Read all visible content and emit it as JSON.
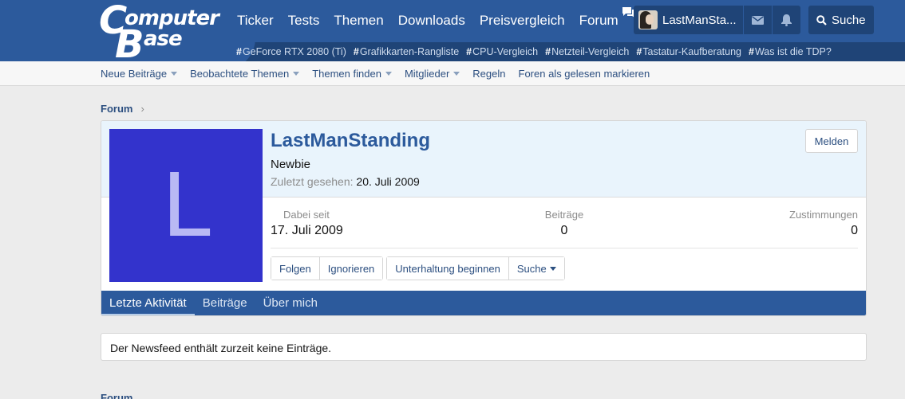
{
  "header": {
    "logo": {
      "line1": "omputer",
      "line2": "ase",
      "letter1": "C",
      "letter2": "B"
    },
    "nav": [
      "Ticker",
      "Tests",
      "Themen",
      "Downloads",
      "Preisvergleich",
      "Forum"
    ],
    "user": {
      "name": "LastManSta..."
    },
    "search_label": "Suche",
    "hashtags": [
      "GeForce RTX 2080 (Ti)",
      "Grafikkarten-Rangliste",
      "CPU-Vergleich",
      "Netzteil-Vergleich",
      "Tastatur-Kaufberatung",
      "Was ist die TDP?"
    ],
    "hash_symbol": "#"
  },
  "subnav": [
    "Neue Beiträge",
    "Beobachtete Themen",
    "Themen finden",
    "Mitglieder",
    "Regeln",
    "Foren als gelesen markieren"
  ],
  "breadcrumb": {
    "item": "Forum",
    "separator": "›"
  },
  "profile": {
    "avatar_letter": "L",
    "avatar_color": "#3333cc",
    "name": "LastManStanding",
    "report_label": "Melden",
    "title": "Newbie",
    "last_seen_label": "Zuletzt gesehen:",
    "last_seen_value": "20. Juli 2009",
    "stats": {
      "joined_label": "Dabei seit",
      "joined_value": "17. Juli 2009",
      "posts_label": "Beiträge",
      "posts_value": "0",
      "reactions_label": "Zustimmungen",
      "reactions_value": "0"
    },
    "actions": {
      "follow": "Folgen",
      "ignore": "Ignorieren",
      "conversation": "Unterhaltung beginnen",
      "search": "Suche"
    },
    "tabs": [
      "Letzte Aktivität",
      "Beiträge",
      "Über mich"
    ]
  },
  "newsfeed": {
    "message": "Der Newsfeed enthält zurzeit keine Einträge."
  },
  "footer": {
    "crumb": "Forum"
  },
  "colors": {
    "brand": "#2c5a9c",
    "brand_dark": "#1f4477",
    "link": "#2c4f80",
    "profile_bg": "#e9f4fc"
  }
}
